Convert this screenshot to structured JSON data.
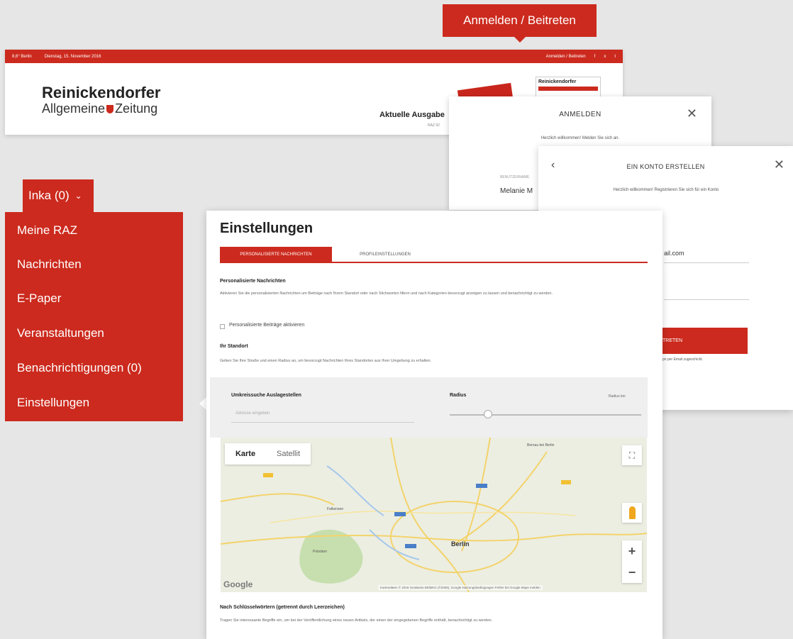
{
  "cta": {
    "label": "Anmelden / Beitreten"
  },
  "site": {
    "topbar": {
      "weather": "8,6° Berlin",
      "date": "Dienstag, 15. November 2016",
      "links": "Anmelden / Beitreten",
      "fb": "f",
      "xing": "x",
      "tw": "t"
    },
    "logo_line1": "Reinickendorfer",
    "logo_line2_a": "Allgemeine",
    "logo_line2_b": "Zeitung",
    "issue_title": "Aktuelle Ausgabe",
    "issue_sub": "RAZ 92",
    "newspaper_title": "Reinickendorfer"
  },
  "login": {
    "title": "ANMELDEN",
    "close": "✕",
    "subtitle": "Herzlich willkommen! Melden Sie sich an.",
    "user_label": "BENUTZERNAME",
    "user_value": "Melanie M"
  },
  "register": {
    "back": "‹",
    "title": "EIN KONTO ERSTELLEN",
    "close": "✕",
    "subtitle": "Herzlich willkommen! Registrieren Sie sich für ein Konto",
    "email_value": "ail.com",
    "button": "TRETEN",
    "note": "pn per Email zugeschickt."
  },
  "user_menu": {
    "tab_label": "Inka (0)",
    "chevron": "⌄",
    "items": [
      "Meine RAZ",
      "Nachrichten",
      "E-Paper",
      "Veranstaltungen",
      "Benachrichtigungen (0)",
      "Einstellungen"
    ]
  },
  "settings": {
    "title": "Einstellungen",
    "tabs": [
      "PERSONALISIERTE NACHRICHTEN",
      "PROFILEINSTELLUNGEN"
    ],
    "section1_title": "Personalisierte Nachrichten",
    "section1_text": "Aktivieren Sie die personalisierten Nachrichten um Beiträge nach Ihrem Standort oder nach Stichworten filtern und nach Kategorien bevorzugt anzeigen zu lassen und benachrichtigt zu werden.",
    "checkbox_label": "Personalisierte Beiträge aktivieren",
    "section2_title": "Ihr Standort",
    "section2_text": "Geben Sie Ihre Straße und einen Radius an, um bevorzugt Nachrichten Ihres Standortes aus Ihrer Umgebung zu erhalten.",
    "location_title": "Umkreissuche Auslagestellen",
    "location_placeholder": "Adresse eingeben",
    "radius_title": "Radius",
    "radius_value": "Radius km",
    "radius_level": 0.2,
    "map": {
      "tab_map": "Karte",
      "tab_sat": "Satellit",
      "fullscreen": "⛶",
      "zoom_in": "+",
      "zoom_out": "−",
      "city": "Berlin",
      "google": "Google",
      "copyright": "Kartendaten © 2016 GeoBasis-DE/BKG (©2009), Google   Nutzungsbedingungen   Fehler bei Google Maps melden",
      "place_a": "Bernau bei Berlin",
      "place_b": "Falkensee",
      "place_c": "Potsdam"
    },
    "section3_title": "Nach Schlüsselwörtern (getrennt durch Leerzeichen)",
    "section3_text": "Tragen Sie interessante Begriffe ein, um bei der Veröffentlichung eines neuen Artikels, der einen der eingegebenen Begriffe enthält, benachrichtigt zu werden."
  }
}
